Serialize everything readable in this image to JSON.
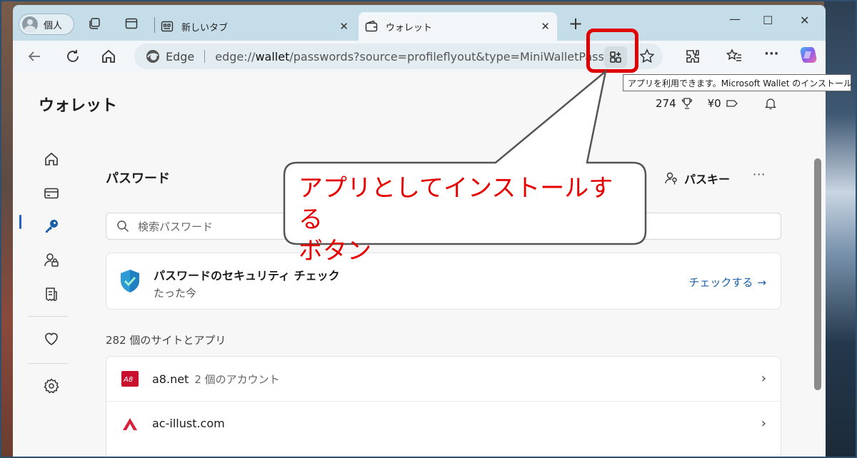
{
  "tabs": {
    "profile_label": "個人",
    "inactive_tab_title": "新しいタブ",
    "active_tab_title": "ウォレット"
  },
  "toolbar": {
    "edge_label": "Edge",
    "url_prefix": "edge://",
    "url_host": "wallet",
    "url_rest": "/passwords?source=profileflyout&type=MiniWalletPassw..."
  },
  "tooltip": {
    "text": "アプリを利用できます。Microsoft Wallet のインストール"
  },
  "callout": {
    "text": "アプリとしてインストールするボタン",
    "line1": "アプリとしてインストールする",
    "line2": "ボタン",
    "color": "#e60000"
  },
  "wallet": {
    "title": "ウォレット",
    "rewards_points": "274",
    "cashback": "¥0"
  },
  "passwords": {
    "heading": "パスワード",
    "passkey_label": "パスキー",
    "more_label": "···",
    "search_placeholder": "検索パスワード",
    "security_title": "パスワードのセキュリティ チェック",
    "security_sub": "たった今",
    "check_label": "チェックする",
    "count_label": "282 個のサイトとアプリ",
    "sites": [
      {
        "name": "a8.net",
        "extra": "2 個のアカウント",
        "icon": "a8-logo"
      },
      {
        "name": "ac-illust.com",
        "extra": "",
        "icon": "ac-logo"
      }
    ]
  },
  "colors": {
    "accent_link": "#1a5fa9",
    "highlight": "#e00000",
    "tab_strip": "#c5dde8"
  }
}
